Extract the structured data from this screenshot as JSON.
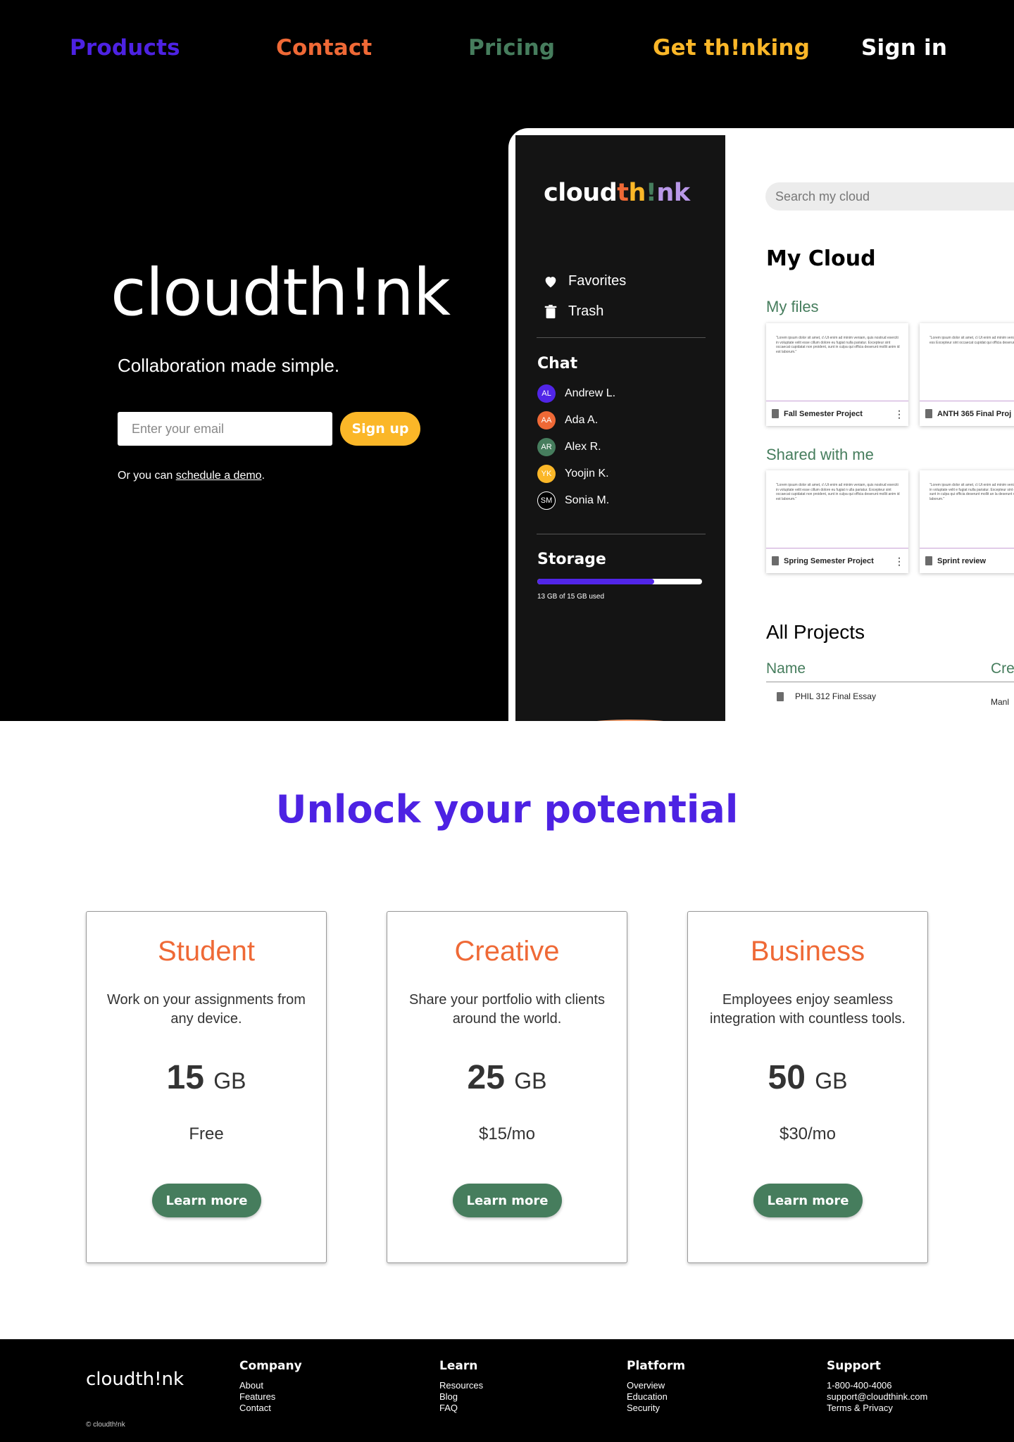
{
  "nav": {
    "products": "Products",
    "contact": "Contact",
    "pricing": "Pricing",
    "get_thinking": "Get th!nking",
    "sign_in": "Sign in",
    "colors": {
      "products": "#4d22e3",
      "contact": "#ef6936",
      "pricing": "#467d5d",
      "get_thinking": "#fbb728",
      "sign_in": "#ffffff"
    }
  },
  "hero": {
    "logo": "cloudth!nk",
    "tagline": "Collaboration made simple.",
    "email_placeholder": "Enter your email",
    "signup_label": "Sign up",
    "demo_prefix": "Or you can ",
    "demo_link": "schedule a demo",
    "demo_suffix": "."
  },
  "app": {
    "logo_parts": [
      "cloud",
      "t",
      "h",
      "!",
      "n",
      "k"
    ],
    "logo_colors": [
      "#ffffff",
      "#ef6936",
      "#fbb728",
      "#467d5d",
      "#b998e8",
      "#b998e8"
    ],
    "sidebar": {
      "favorites": "Favorites",
      "trash": "Trash",
      "chat_heading": "Chat",
      "chat": [
        {
          "initials": "AL",
          "name": "Andrew L.",
          "color": "#5125e8"
        },
        {
          "initials": "AA",
          "name": "Ada A.",
          "color": "#ef6936"
        },
        {
          "initials": "AR",
          "name": "Alex R.",
          "color": "#467d5d"
        },
        {
          "initials": "YK",
          "name": "Yoojin K.",
          "color": "#fbb728"
        },
        {
          "initials": "SM",
          "name": "Sonia M.",
          "color": "#000000"
        }
      ],
      "storage_heading": "Storage",
      "storage_used_fraction": 0.71,
      "storage_text": "13 GB of 15 GB used"
    },
    "search_placeholder": "Search my cloud",
    "title": "My Cloud",
    "my_files_heading": "My files",
    "my_files": [
      {
        "name": "Fall Semester Project",
        "body": "\"Lorem ipsum dolor sit amet, c\\ Ut enim ad minim veniam, quis nostrud exerciti in voluptate velit esse cillum dolore eu fugiat nulla pariatur. Excepteur sint occaecat cupidatat non proident, sunt in culpa qui officia deserunt mollit anim id est laborum.\""
      },
      {
        "name": "ANTH 365 Final Proj",
        "body": "\"Lorem ipsum dolor sit amet, c\\ Ut enim ad minim veniam, quis nostrud e velit ess Excepteur sint occaecat cupidat qui officia deserunt mollit anim id"
      }
    ],
    "shared_heading": "Shared with me",
    "shared_files": [
      {
        "name": "Spring Semester Project",
        "body": "\"Lorem ipsum dolor sit amet, c\\ Ut enim ad minim veniam, quis nostrud exerciti in voluptate velit esse cillum dolore eu fugiat n ulla pariatur. Excepteur sint occaecat cupidatat non proident, sunt in culpa qui officia deserunt mollit anim id est laborum.\""
      },
      {
        "name": "Sprint review",
        "body": "\"Lorem ipsum dolor sit amet, c\\ Ut enim ad minim veniam , quis nostrud exerciti in voluptate velit e fugiat nulla pariatur. Excepteur sint occaecat cupidat proident, sunt in culpa qui officia deserunt mollit an la deserunt mollit anim id est laborum.\""
      }
    ],
    "all_projects": "All Projects",
    "table_name_header": "Name",
    "table_created_header": "Cre",
    "rows": [
      {
        "name": "PHIL 312 Final Essay",
        "created": "Manl"
      }
    ]
  },
  "plans": {
    "heading": "Unlock your potential",
    "cards": [
      {
        "name": "Student",
        "desc": "Work on your assignments from any device.",
        "size": "15",
        "unit": "GB",
        "price": "Free",
        "button": "Learn more"
      },
      {
        "name": "Creative",
        "desc": "Share your portfolio with clients around the world.",
        "size": "25",
        "unit": "GB",
        "price": "$15/mo",
        "button": "Learn more"
      },
      {
        "name": "Business",
        "desc": "Employees enjoy seamless integration with countless tools.",
        "size": "50",
        "unit": "GB",
        "price": "$30/mo",
        "button": "Learn more"
      }
    ]
  },
  "footer": {
    "logo": "cloudth!nk",
    "copyright": "© cloudth!nk",
    "company": {
      "heading": "Company",
      "links": [
        "About",
        "Features",
        "Contact"
      ]
    },
    "learn": {
      "heading": "Learn",
      "links": [
        "Resources",
        "Blog",
        "FAQ"
      ]
    },
    "platform": {
      "heading": "Platform",
      "links": [
        "Overview",
        "Education",
        "Security"
      ]
    },
    "support": {
      "heading": "Support",
      "links": [
        "1-800-400-4006",
        "support@cloudthink.com",
        "Terms & Privacy"
      ]
    }
  }
}
